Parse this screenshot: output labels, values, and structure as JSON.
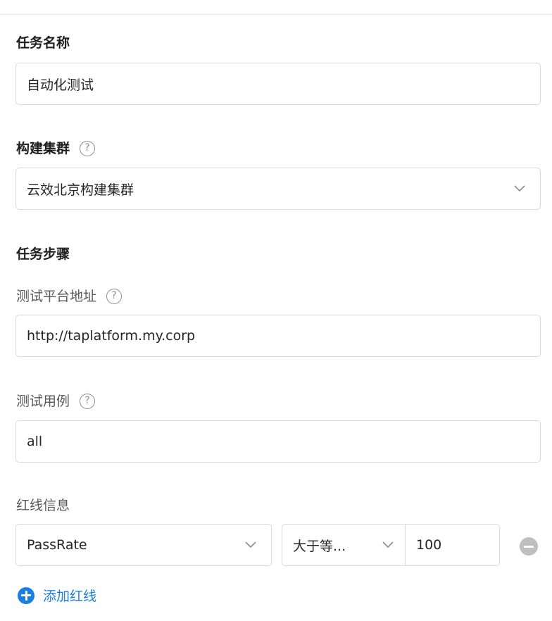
{
  "form": {
    "task_name": {
      "label": "任务名称",
      "value": "自动化测试"
    },
    "build_cluster": {
      "label": "构建集群",
      "help_icon": "question-circle-icon",
      "value": "云效北京构建集群",
      "dropdown_icon": "chevron-down-icon"
    },
    "task_steps": {
      "label": "任务步骤"
    },
    "test_platform": {
      "label": "测试平台地址",
      "help_icon": "question-circle-icon",
      "value": "http://taplatform.my.corp"
    },
    "test_cases": {
      "label": "测试用例",
      "help_icon": "question-circle-icon",
      "value": "all"
    },
    "redline": {
      "label": "红线信息",
      "rows": [
        {
          "metric": "PassRate",
          "operator": "大于等...",
          "threshold": "100"
        }
      ],
      "add_label": "添加红线"
    },
    "help_glyph": "?"
  },
  "colors": {
    "accent": "#1b7ee3",
    "border": "#d9d9d9",
    "muted_icon": "#bfbfbf"
  }
}
